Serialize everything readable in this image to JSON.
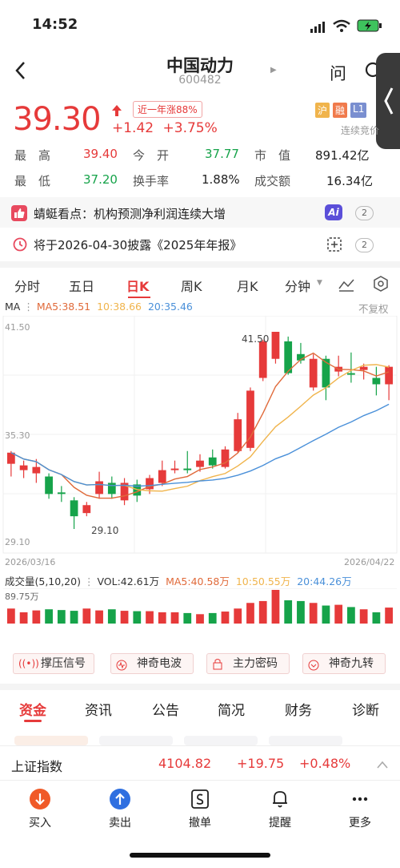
{
  "status": {
    "time": "14:52"
  },
  "header": {
    "title": "中国动力",
    "code": "600482",
    "ask_label": "问"
  },
  "quote": {
    "price": "39.30",
    "change": "+1.42",
    "change_pct": "+3.75%",
    "year_badge": "近一年涨88%",
    "tags": [
      "沪",
      "融",
      "L1"
    ],
    "auction": "连续竞价"
  },
  "stats": [
    {
      "label": "最　高",
      "value": "39.40",
      "color": "#e63a3a"
    },
    {
      "label": "今　开",
      "value": "37.77",
      "color": "#16a34a"
    },
    {
      "label": "市　值",
      "value": "891.42亿",
      "color": "#222222"
    },
    {
      "label": "最　低",
      "value": "37.20",
      "color": "#16a34a"
    },
    {
      "label": "换手率",
      "value": "1.88%",
      "color": "#222222"
    },
    {
      "label": "成交额",
      "value": "16.34亿",
      "color": "#222222"
    }
  ],
  "banners": {
    "insight": "蜻蜓看点：机构预测净利润连续大增",
    "insight_count": "2",
    "disclosure": "将于2026-04-30披露《2025年年报》",
    "disclosure_count": "2",
    "ai_label": "Ai"
  },
  "chart_tabs": [
    "分时",
    "五日",
    "日K",
    "周K",
    "月K",
    "分钟"
  ],
  "active_chart_tab": 2,
  "ma_line": {
    "title": "MA",
    "ma5": "MA5:38.51",
    "ma10": "10:38.66",
    "ma20": "20:35.46",
    "adjust": "不复权"
  },
  "chart_labels": {
    "max_y": "41.50",
    "mid_y": "35.30",
    "min_y": "29.10",
    "high_mark": "41.50",
    "low_mark": "29.10",
    "start_date": "2026/03/16",
    "end_date": "2026/04/22"
  },
  "volume_line": {
    "title": "成交量(5,10,20)",
    "vol": "VOL:42.61万",
    "ma5": "MA5:40.58万",
    "ma10": "10:50.55万",
    "ma20": "20:44.26万",
    "max": "89.75万"
  },
  "colors": {
    "up": "#e63a3a",
    "down": "#16a34a",
    "ma5": "#e06a3a",
    "ma10": "#f0b44c",
    "ma20": "#4a90d9"
  },
  "chart_data": {
    "type": "candlestick",
    "dates": [
      "2026/03/16",
      "2026/04/22"
    ],
    "candles": [
      [
        33.2,
        33.9,
        32.4,
        34.0
      ],
      [
        32.8,
        33.1,
        32.3,
        33.4
      ],
      [
        32.6,
        33.0,
        32.0,
        33.5
      ],
      [
        32.4,
        31.3,
        31.0,
        32.6
      ],
      [
        31.4,
        31.3,
        30.8,
        31.8
      ],
      [
        30.9,
        29.9,
        29.1,
        31.1
      ],
      [
        30.1,
        30.6,
        29.9,
        30.8
      ],
      [
        31.3,
        32.1,
        31.0,
        32.7
      ],
      [
        32.0,
        31.3,
        31.0,
        32.4
      ],
      [
        30.9,
        32.0,
        30.6,
        32.3
      ],
      [
        31.9,
        31.2,
        30.8,
        32.2
      ],
      [
        31.6,
        32.3,
        31.3,
        32.5
      ],
      [
        32.0,
        32.8,
        31.8,
        33.4
      ],
      [
        32.8,
        32.9,
        32.6,
        33.4
      ],
      [
        32.9,
        32.8,
        32.6,
        34.0
      ],
      [
        33.0,
        33.4,
        32.7,
        33.8
      ],
      [
        33.6,
        33.1,
        32.9,
        34.1
      ],
      [
        33.0,
        34.1,
        32.9,
        34.3
      ],
      [
        34.0,
        36.0,
        33.9,
        36.4
      ],
      [
        34.2,
        37.8,
        34.0,
        38.0
      ],
      [
        38.6,
        40.9,
        38.4,
        41.0
      ],
      [
        39.8,
        41.5,
        39.5,
        41.5
      ],
      [
        40.9,
        38.9,
        38.8,
        41.2
      ],
      [
        40.1,
        39.7,
        39.5,
        40.8
      ],
      [
        38.0,
        39.8,
        37.8,
        40.1
      ],
      [
        39.8,
        38.0,
        37.2,
        40.0
      ],
      [
        39.0,
        39.3,
        38.7,
        40.0
      ],
      [
        38.9,
        38.8,
        38.3,
        40.2
      ],
      [
        39.1,
        39.3,
        38.5,
        39.5
      ],
      [
        38.6,
        38.2,
        37.5,
        39.3
      ],
      [
        38.2,
        39.3,
        37.2,
        39.4
      ]
    ],
    "volume": [
      40,
      30,
      35,
      38,
      36,
      34,
      40,
      35,
      38,
      34,
      33,
      33,
      30,
      30,
      28,
      25,
      28,
      32,
      40,
      55,
      60,
      89.75,
      62,
      60,
      55,
      48,
      50,
      44,
      38,
      30,
      42.61
    ],
    "ylim": [
      29.1,
      41.5
    ],
    "vol_max": 89.75
  },
  "indicators": [
    "撑压信号",
    "神奇电波",
    "主力密码",
    "神奇九转"
  ],
  "section_tabs": [
    "资金",
    "资讯",
    "公告",
    "简况",
    "财务",
    "诊断"
  ],
  "active_section_tab": 0,
  "index_bar": {
    "name": "上证指数",
    "value": "4104.82",
    "change": "+19.75",
    "change_pct": "+0.48%"
  },
  "bottom_nav": [
    {
      "label": "买入",
      "icon": "buy-icon"
    },
    {
      "label": "卖出",
      "icon": "sell-icon"
    },
    {
      "label": "撤单",
      "icon": "cancel-order-icon"
    },
    {
      "label": "提醒",
      "icon": "bell-icon"
    },
    {
      "label": "更多",
      "icon": "more-icon"
    }
  ]
}
